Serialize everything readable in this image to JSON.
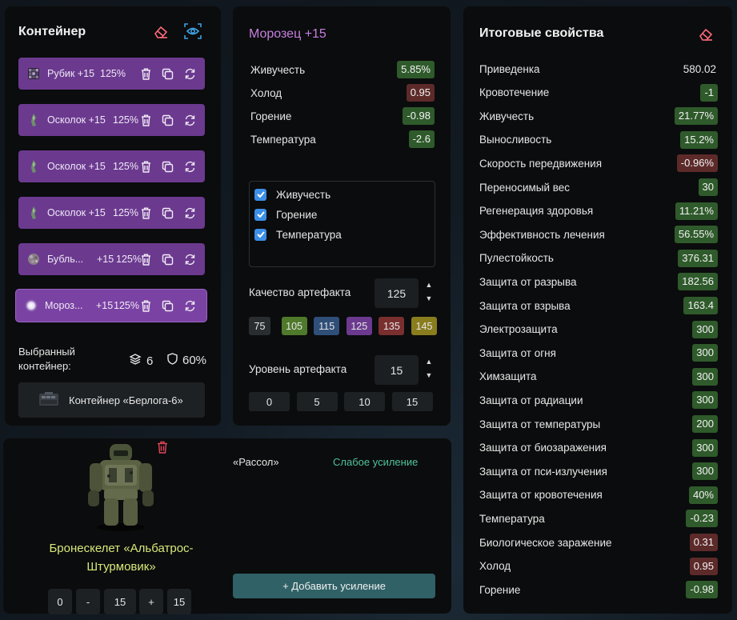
{
  "container": {
    "title": "Контейнер",
    "artifacts": [
      {
        "name": "Рубик +15",
        "pct": "125%",
        "icon": "rubik-icon"
      },
      {
        "name": "Осколок +15",
        "pct": "125%",
        "icon": "shard-icon"
      },
      {
        "name": "Осколок +15",
        "pct": "125%",
        "icon": "shard-icon"
      },
      {
        "name": "Осколок +15",
        "pct": "125%",
        "icon": "shard-icon"
      },
      {
        "name": "Бубль...",
        "level": "+15",
        "pct": "125%",
        "icon": "bubble-icon"
      },
      {
        "name": "Мороз...",
        "level": "+15",
        "pct": "125%",
        "icon": "frost-icon"
      }
    ],
    "selected_label": "Выбранный контейнер:",
    "slots": "6",
    "protection": "60%",
    "container_name": "Контейнер «Берлога-6»"
  },
  "artifact": {
    "title": "Морозец +15",
    "stats": [
      {
        "name": "Живучесть",
        "value": "5.85%",
        "tone": "green"
      },
      {
        "name": "Холод",
        "value": "0.95",
        "tone": "red"
      },
      {
        "name": "Горение",
        "value": "-0.98",
        "tone": "green"
      },
      {
        "name": "Температура",
        "value": "-2.6",
        "tone": "green"
      }
    ],
    "checks": [
      "Живучесть",
      "Горение",
      "Температура"
    ],
    "quality_label": "Качество артефакта",
    "quality_value": "125",
    "quality_presets": [
      {
        "label": "75",
        "color": "#2a2d30"
      },
      {
        "label": "105",
        "color": "#4f7a2c"
      },
      {
        "label": "115",
        "color": "#2f4f78"
      },
      {
        "label": "125",
        "color": "#6b3a8f"
      },
      {
        "label": "135",
        "color": "#7a2f2f"
      },
      {
        "label": "145",
        "color": "#8a7d1e"
      }
    ],
    "level_label": "Уровень артефакта",
    "level_value": "15",
    "level_presets": [
      "0",
      "5",
      "10",
      "15"
    ]
  },
  "final": {
    "title": "Итоговые свойства",
    "stats": [
      {
        "name": "Приведенка",
        "value": "580.02",
        "tone": "plain"
      },
      {
        "name": "Кровотечение",
        "value": "-1",
        "tone": "green"
      },
      {
        "name": "Живучесть",
        "value": "21.77%",
        "tone": "green"
      },
      {
        "name": "Выносливость",
        "value": "15.2%",
        "tone": "green"
      },
      {
        "name": "Скорость передвижения",
        "value": "-0.96%",
        "tone": "red"
      },
      {
        "name": "Переносимый вес",
        "value": "30",
        "tone": "green"
      },
      {
        "name": "Регенерация здоровья",
        "value": "11.21%",
        "tone": "green"
      },
      {
        "name": "Эффективность лечения",
        "value": "56.55%",
        "tone": "green"
      },
      {
        "name": "Пулестойкость",
        "value": "376.31",
        "tone": "green"
      },
      {
        "name": "Защита от разрыва",
        "value": "182.56",
        "tone": "green"
      },
      {
        "name": "Защита от взрыва",
        "value": "163.4",
        "tone": "green"
      },
      {
        "name": "Электрозащита",
        "value": "300",
        "tone": "green"
      },
      {
        "name": "Защита от огня",
        "value": "300",
        "tone": "green"
      },
      {
        "name": "Химзащита",
        "value": "300",
        "tone": "green"
      },
      {
        "name": "Защита от радиации",
        "value": "300",
        "tone": "green"
      },
      {
        "name": "Защита от температуры",
        "value": "200",
        "tone": "green"
      },
      {
        "name": "Защита от биозаражения",
        "value": "300",
        "tone": "green"
      },
      {
        "name": "Защита от пси-излучения",
        "value": "300",
        "tone": "green"
      },
      {
        "name": "Защита от кровотечения",
        "value": "40%",
        "tone": "green"
      },
      {
        "name": "Температура",
        "value": "-0.23",
        "tone": "green"
      },
      {
        "name": "Биологическое заражение",
        "value": "0.31",
        "tone": "red"
      },
      {
        "name": "Холод",
        "value": "0.95",
        "tone": "red"
      },
      {
        "name": "Горение",
        "value": "-0.98",
        "tone": "green"
      }
    ]
  },
  "armor": {
    "name": "Бронескелет «Альбатрос-Штурмовик»",
    "upgrade_name": "«Рассол»",
    "upgrade_strength": "Слабое усиление",
    "stepper": {
      "min": "0",
      "minus": "-",
      "value": "15",
      "plus": "+",
      "max": "15"
    },
    "add_upgrade": "+ Добавить усиление"
  },
  "colors": {
    "artifact_title": "#c77fe0",
    "armor_name": "#d8e87a",
    "upgrade_strength": "#4fc39a",
    "eye_icon": "#3da0e0",
    "eraser_icon": "#ff6b7a",
    "trash_red": "#e0475a"
  }
}
